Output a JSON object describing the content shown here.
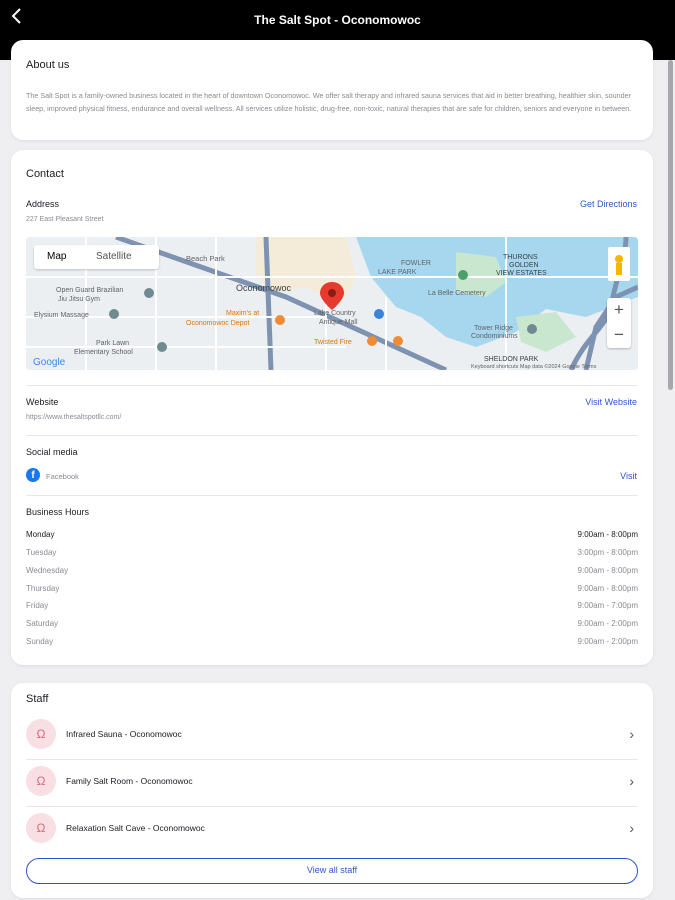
{
  "header": {
    "back_icon": "chevron-left-icon",
    "title": "The Salt Spot - Oconomowoc"
  },
  "about": {
    "heading": "About us",
    "text": "The Salt Spot is a family-owned business located in the heart of downtown Oconomowoc. We offer salt therapy and infrared sauna services that aid in better breathing, healthier skin, sounder sleep, improved physical fitness, endurance and overall wellness. All services utilize holistic, drug-free, non-toxic, natural therapies that are safe for children, seniors and everyone in between."
  },
  "contact": {
    "heading": "Contact",
    "address_label": "Address",
    "address": "227 East Pleasant Street",
    "directions": "Get Directions",
    "map": {
      "tab_map": "Map",
      "tab_satellite": "Satellite",
      "places": [
        "Beach Park",
        "Oconomowoc",
        "Open Guard Brazilian Jiu Jitsu Gym",
        "Elysium Massage",
        "Maxim's at Oconomowoc Depot",
        "Fowler Lake Park",
        "La Belle Cemetery",
        "Thurows Golden View Estates",
        "Tower Ridge Condominiums",
        "Park Lawn Elementary School",
        "Lake Country Antique Mall",
        "Twisted Fire",
        "Sheldon Park"
      ],
      "attribution": "Keyboard shortcuts   Map data ©2024 Google   Terms",
      "google": "Google"
    },
    "website_label": "Website",
    "website": "https://www.thesaltspotllc.com/",
    "visit_website": "Visit Website",
    "social_label": "Social media",
    "facebook": "Facebook",
    "visit": "Visit",
    "hours_label": "Business Hours",
    "hours": [
      {
        "day": "Monday",
        "time": "9:00am - 8:00pm"
      },
      {
        "day": "Tuesday",
        "time": "3:00pm - 8:00pm"
      },
      {
        "day": "Wednesday",
        "time": "9:00am - 8:00pm"
      },
      {
        "day": "Thursday",
        "time": "9:00am - 8:00pm"
      },
      {
        "day": "Friday",
        "time": "9:00am - 7:00pm"
      },
      {
        "day": "Saturday",
        "time": "9:00am - 2:00pm"
      },
      {
        "day": "Sunday",
        "time": "9:00am - 2:00pm"
      }
    ]
  },
  "staff": {
    "heading": "Staff",
    "items": [
      {
        "name": "Infrared Sauna - Oconomowoc"
      },
      {
        "name": "Family Salt Room - Oconomowoc"
      },
      {
        "name": "Relaxation Salt Cave - Oconomowoc"
      }
    ],
    "view_all": "View all staff"
  },
  "colors": {
    "accent": "#2f56c8",
    "header_bg": "#000000",
    "avatar_bg": "#f7dfe3"
  }
}
